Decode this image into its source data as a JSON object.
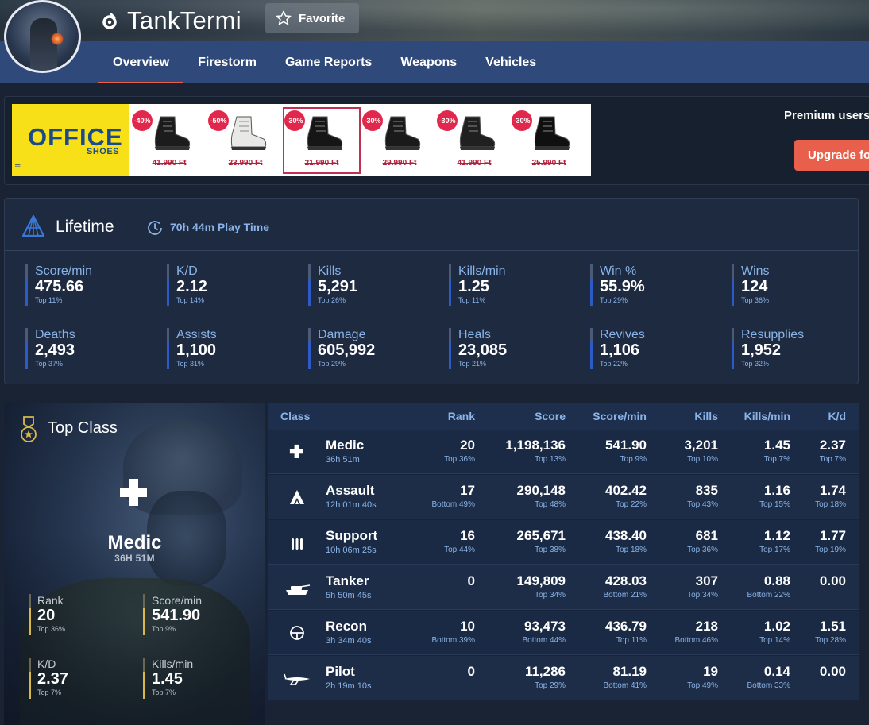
{
  "header": {
    "username": "TankTermi",
    "favorite_label": "Favorite",
    "tabs": [
      {
        "label": "Overview",
        "active": true
      },
      {
        "label": "Firestorm"
      },
      {
        "label": "Game Reports"
      },
      {
        "label": "Weapons"
      },
      {
        "label": "Vehicles"
      }
    ]
  },
  "ad": {
    "logo_main": "OFFICE",
    "logo_sub": "SHOES",
    "logo_mark": "═",
    "products": [
      {
        "discount": "-40%",
        "price": "41.990 Ft",
        "color": "#1c1c1c"
      },
      {
        "discount": "-50%",
        "price": "23.990 Ft",
        "color": "#e8e8e6"
      },
      {
        "discount": "-30%",
        "price": "21.990 Ft",
        "color": "#161616"
      },
      {
        "discount": "-30%",
        "price": "29.990 Ft",
        "color": "#1a1a1a"
      },
      {
        "discount": "-30%",
        "price": "41.990 Ft",
        "color": "#202020"
      },
      {
        "discount": "-30%",
        "price": "25.990 Ft",
        "color": "#101010"
      }
    ],
    "premium_text": "Premium users c",
    "upgrade_label": "Upgrade fo"
  },
  "lifetime": {
    "title": "Lifetime",
    "play_time": "70h 44m Play Time",
    "stats": [
      {
        "label": "Score/min",
        "value": "475.66",
        "rank": "Top 11%"
      },
      {
        "label": "K/D",
        "value": "2.12",
        "rank": "Top 14%"
      },
      {
        "label": "Kills",
        "value": "5,291",
        "rank": "Top 26%"
      },
      {
        "label": "Kills/min",
        "value": "1.25",
        "rank": "Top 11%"
      },
      {
        "label": "Win %",
        "value": "55.9%",
        "rank": "Top 29%"
      },
      {
        "label": "Wins",
        "value": "124",
        "rank": "Top 36%"
      },
      {
        "label": "Deaths",
        "value": "2,493",
        "rank": "Top 37%"
      },
      {
        "label": "Assists",
        "value": "1,100",
        "rank": "Top 31%"
      },
      {
        "label": "Damage",
        "value": "605,992",
        "rank": "Top 29%"
      },
      {
        "label": "Heals",
        "value": "23,085",
        "rank": "Top 21%"
      },
      {
        "label": "Revives",
        "value": "1,106",
        "rank": "Top 22%"
      },
      {
        "label": "Resupplies",
        "value": "1,952",
        "rank": "Top 32%"
      }
    ]
  },
  "top_class": {
    "title": "Top Class",
    "name": "Medic",
    "time": "36H 51M",
    "stats": [
      {
        "label": "Rank",
        "value": "20",
        "rank": "Top 36%"
      },
      {
        "label": "Score/min",
        "value": "541.90",
        "rank": "Top 9%"
      },
      {
        "label": "K/D",
        "value": "2.37",
        "rank": "Top 7%"
      },
      {
        "label": "Kills/min",
        "value": "1.45",
        "rank": "Top 7%"
      }
    ]
  },
  "classes": {
    "headers": [
      "Class",
      "Rank",
      "Score",
      "Score/min",
      "Kills",
      "Kills/min",
      "K/d"
    ],
    "rows": [
      {
        "name": "Medic",
        "time": "36h 51m",
        "icon": "medic-cross-icon",
        "cells": [
          [
            "20",
            "Top 36%"
          ],
          [
            "1,198,136",
            "Top 13%"
          ],
          [
            "541.90",
            "Top 9%"
          ],
          [
            "3,201",
            "Top 10%"
          ],
          [
            "1.45",
            "Top 7%"
          ],
          [
            "2.37",
            "Top 7%"
          ]
        ]
      },
      {
        "name": "Assault",
        "time": "12h 01m 40s",
        "icon": "assault-chevron-icon",
        "cells": [
          [
            "17",
            "Bottom 49%"
          ],
          [
            "290,148",
            "Top 48%"
          ],
          [
            "402.42",
            "Top 22%"
          ],
          [
            "835",
            "Top 43%"
          ],
          [
            "1.16",
            "Top 15%"
          ],
          [
            "1.74",
            "Top 18%"
          ]
        ]
      },
      {
        "name": "Support",
        "time": "10h 06m 25s",
        "icon": "support-ammo-icon",
        "cells": [
          [
            "16",
            "Top 44%"
          ],
          [
            "265,671",
            "Top 38%"
          ],
          [
            "438.40",
            "Top 18%"
          ],
          [
            "681",
            "Top 36%"
          ],
          [
            "1.12",
            "Top 17%"
          ],
          [
            "1.77",
            "Top 19%"
          ]
        ]
      },
      {
        "name": "Tanker",
        "time": "5h 50m 45s",
        "icon": "tank-icon",
        "cells": [
          [
            "0",
            ""
          ],
          [
            "149,809",
            "Top 34%"
          ],
          [
            "428.03",
            "Bottom 21%"
          ],
          [
            "307",
            "Top 34%"
          ],
          [
            "0.88",
            "Bottom 22%"
          ],
          [
            "0.00",
            ""
          ]
        ]
      },
      {
        "name": "Recon",
        "time": "3h 34m 40s",
        "icon": "recon-scope-icon",
        "cells": [
          [
            "10",
            "Bottom 39%"
          ],
          [
            "93,473",
            "Bottom 44%"
          ],
          [
            "436.79",
            "Top 11%"
          ],
          [
            "218",
            "Bottom 46%"
          ],
          [
            "1.02",
            "Top 14%"
          ],
          [
            "1.51",
            "Top 28%"
          ]
        ]
      },
      {
        "name": "Pilot",
        "time": "2h 19m 10s",
        "icon": "plane-icon",
        "cells": [
          [
            "0",
            ""
          ],
          [
            "11,286",
            "Top 29%"
          ],
          [
            "81.19",
            "Bottom 41%"
          ],
          [
            "19",
            "Top 49%"
          ],
          [
            "0.14",
            "Bottom 33%"
          ],
          [
            "0.00",
            ""
          ]
        ]
      }
    ]
  }
}
